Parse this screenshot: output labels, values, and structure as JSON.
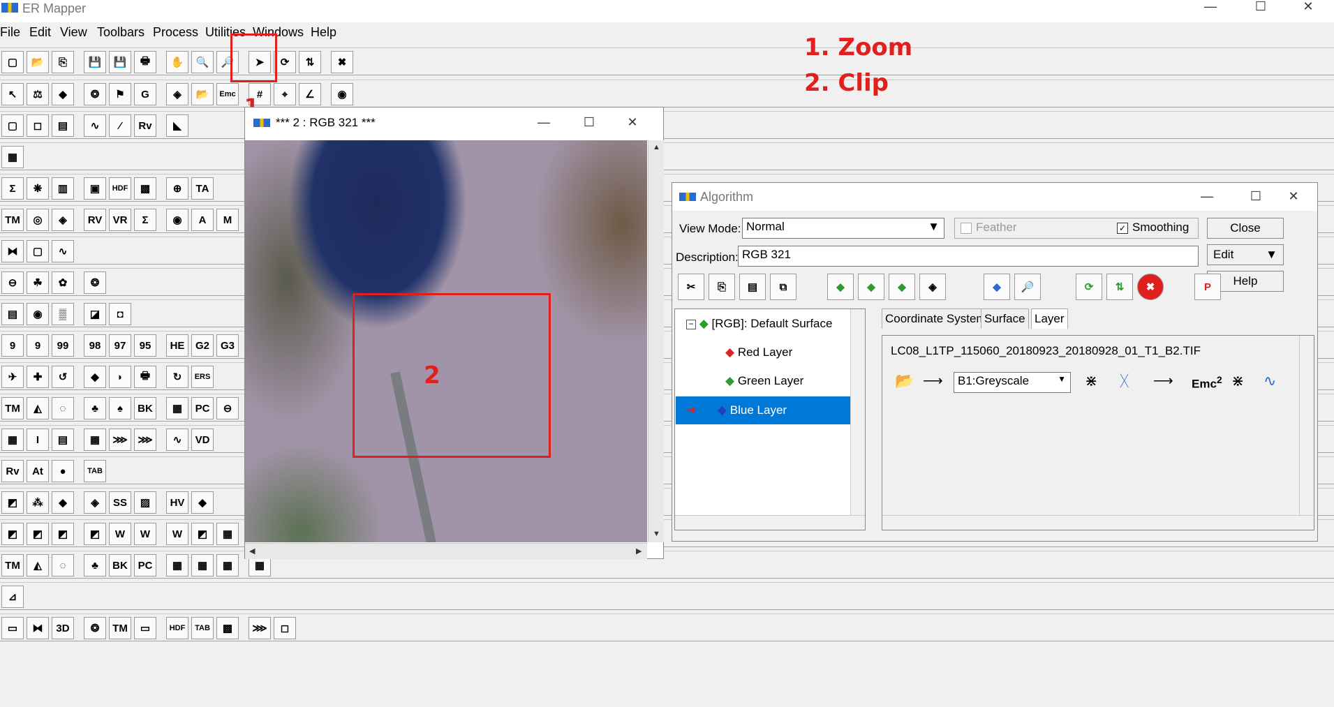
{
  "app": {
    "title": "ER Mapper"
  },
  "window_controls": {
    "minimize": "—",
    "maximize": "☐",
    "close": "✕"
  },
  "menu": [
    "File",
    "Edit",
    "View",
    "Toolbars",
    "Process",
    "Utilities",
    "Windows",
    "Help"
  ],
  "annotations": {
    "steps": [
      "1. Zoom",
      "2. Clip"
    ],
    "marker1": "1",
    "marker2": "2"
  },
  "toolbar_glyphs": {
    "row1": [
      "▢",
      "📂",
      "⎘",
      "💾",
      "💾",
      "🖶",
      "✋",
      "🔍",
      "🔎",
      "➤",
      "⟳",
      "⇅",
      "✖"
    ],
    "row2": [
      "↖",
      "⚖",
      "◆",
      "❂",
      "⚑",
      "G",
      "◈",
      "📂",
      "Emc",
      "#",
      "⌖",
      "∠",
      "◉"
    ],
    "row3": [
      "▢",
      "◻",
      "▤",
      "∿",
      "⁄",
      "Rv",
      "◣"
    ],
    "row4": [
      "▦"
    ],
    "row5": [
      "Σ",
      "❋",
      "▥",
      "▣",
      "HDF",
      "▩",
      "⊕",
      "TA"
    ],
    "row6": [
      "TM",
      "◎",
      "◈",
      "RV",
      "VR",
      "Σ",
      "◉",
      "A",
      "M"
    ],
    "row7": [
      "⧓",
      "▢",
      "∿"
    ],
    "row8": [
      "⊖",
      "☘",
      "✿",
      "❂"
    ],
    "row9": [
      "▤",
      "◉",
      "▒",
      "◪",
      "◘"
    ],
    "row10": [
      "9",
      "9",
      "99",
      "98",
      "97",
      "95",
      "HE",
      "G2",
      "G3"
    ],
    "row11": [
      "✈",
      "✚",
      "↺",
      "◆",
      "◗",
      "🖶",
      "↻",
      "ERS"
    ],
    "row12": [
      "TM",
      "◭",
      "◌",
      "♣",
      "♠",
      "BK",
      "▦",
      "PC",
      "⊖"
    ],
    "row13": [
      "▦",
      "I",
      "▤",
      "▦",
      "⋙",
      "⋙",
      "∿",
      "VD"
    ],
    "row14": [
      "Rv",
      "At",
      "●",
      "TAB"
    ],
    "row15": [
      "◩",
      "⁂",
      "◆",
      "◈",
      "SS",
      "▨",
      "HV",
      "◆"
    ],
    "row16": [
      "◩",
      "◩",
      "◩",
      "◩",
      "W",
      "W",
      "W",
      "◩",
      "▦"
    ],
    "row17": [
      "TM",
      "◭",
      "◌",
      "♣",
      "BK",
      "PC",
      "▦",
      "▦",
      "▦",
      "▦"
    ],
    "row18": [
      "⊿"
    ],
    "row19": [
      "▭",
      "⧓",
      "3D",
      "❂",
      "TM",
      "▭",
      "HDF",
      "TAB",
      "▩",
      "⋙",
      "◻"
    ]
  },
  "image_window": {
    "title": "*** 2 : RGB 321 ***"
  },
  "algorithm_window": {
    "title": "Algorithm",
    "view_mode_label": "View Mode:",
    "view_mode_value": "Normal",
    "feather_label": "Feather",
    "feather_checked": false,
    "smoothing_label": "Smoothing",
    "smoothing_checked": true,
    "close_button": "Close",
    "description_label": "Description:",
    "description_value": "RGB 321",
    "edit_button": "Edit",
    "help_button": "Help",
    "tree": {
      "root": "[RGB]: Default Surface",
      "layers": [
        {
          "label": "Red Layer",
          "letter": "R",
          "color": "#d62828"
        },
        {
          "label": "Green Layer",
          "letter": "G",
          "color": "#2e9b2e"
        },
        {
          "label": "Blue Layer",
          "letter": "B",
          "color": "#1f3fc0",
          "selected": true
        }
      ]
    },
    "tabs": [
      "Coordinate System",
      "Surface",
      "Layer"
    ],
    "active_tab": "Layer",
    "layer_file": "LC08_L1TP_115060_20180923_20180928_01_T1_B2.TIF",
    "band_value": "B1:Greyscale",
    "formula_label": "Emc",
    "formula_sup": "2"
  },
  "colors": {
    "annotation_red": "#e0201e",
    "selection_blue": "#0078d7"
  }
}
